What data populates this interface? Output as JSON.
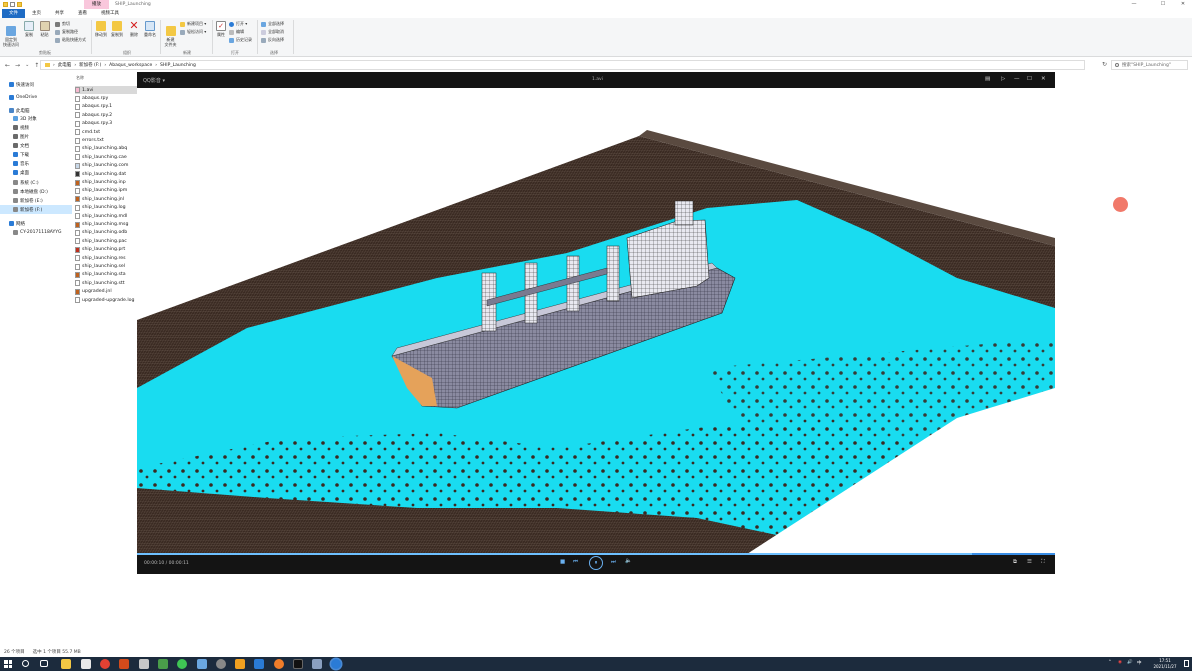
{
  "window": {
    "title": "SHIP_Launching",
    "context_tab": "播放",
    "controls": {
      "minimize": "—",
      "maximize": "☐",
      "close": "✕"
    }
  },
  "ribbon_tabs": [
    "文件",
    "主页",
    "共享",
    "查看",
    "视频工具"
  ],
  "ribbon": {
    "clipboard": {
      "pin_quick": "固定到\n快速访问",
      "copy": "复制",
      "paste": "粘贴",
      "cut": "剪切",
      "copy_path": "复制路径",
      "paste_shortcut": "粘贴快捷方式",
      "group": "剪贴板"
    },
    "organize": {
      "move_to": "移动到",
      "copy_to": "复制到",
      "delete": "删除",
      "rename": "重命名",
      "group": "组织"
    },
    "new": {
      "new_folder": "新建\n文件夹",
      "new_item": "新建项目 ▾",
      "easy_access": "轻松访问 ▾",
      "group": "新建"
    },
    "open": {
      "properties": "属性",
      "open": "打开 ▾",
      "edit": "编辑",
      "history": "历史记录",
      "group": "打开"
    },
    "select": {
      "select_all": "全部选择",
      "select_none": "全部取消",
      "invert": "反向选择",
      "group": "选择"
    }
  },
  "address": {
    "back": "←",
    "forward": "→",
    "recent": "⌄",
    "up": "↑",
    "crumbs": [
      "此电脑",
      "新加卷 (F:)",
      "Abaqus_workspace",
      "SHIP_Launching"
    ],
    "refresh": "↻",
    "search_placeholder": "搜索\"SHIP_Launching\""
  },
  "nav": [
    {
      "label": "快速访问",
      "indent": 0,
      "color": "#2a7bd6"
    },
    {
      "label": "OneDrive",
      "indent": 0,
      "color": "#2a7bd6"
    },
    {
      "label": "此电脑",
      "indent": 0,
      "color": "#4a86c8"
    },
    {
      "label": "3D 对象",
      "indent": 1,
      "color": "#5aa0e0"
    },
    {
      "label": "视频",
      "indent": 1,
      "color": "#6a6a6a"
    },
    {
      "label": "图片",
      "indent": 1,
      "color": "#6a6a6a"
    },
    {
      "label": "文档",
      "indent": 1,
      "color": "#6a6a6a"
    },
    {
      "label": "下载",
      "indent": 1,
      "color": "#2a7bd6"
    },
    {
      "label": "音乐",
      "indent": 1,
      "color": "#2a7bd6"
    },
    {
      "label": "桌面",
      "indent": 1,
      "color": "#2a7bd6"
    },
    {
      "label": "系统 (C:)",
      "indent": 1,
      "color": "#888"
    },
    {
      "label": "本地磁盘 (D:)",
      "indent": 1,
      "color": "#888"
    },
    {
      "label": "新加卷 (E:)",
      "indent": 1,
      "color": "#888"
    },
    {
      "label": "新加卷 (F:)",
      "indent": 1,
      "color": "#888",
      "selected": true
    },
    {
      "label": "网络",
      "indent": 0,
      "color": "#2a7bd6"
    },
    {
      "label": "CY-20171118AYYG",
      "indent": 1,
      "color": "#888"
    }
  ],
  "filelist": {
    "header": "名称",
    "files": [
      {
        "name": "1.avi",
        "icon": "video",
        "selected": true
      },
      {
        "name": "abaqus.rpy",
        "icon": "doc"
      },
      {
        "name": "abaqus.rpy.1",
        "icon": "doc"
      },
      {
        "name": "abaqus.rpy.2",
        "icon": "doc"
      },
      {
        "name": "abaqus.rpy.3",
        "icon": "doc"
      },
      {
        "name": "cmd.txt",
        "icon": "doc"
      },
      {
        "name": "errors.txt",
        "icon": "doc"
      },
      {
        "name": "ship_launching.abq",
        "icon": "doc"
      },
      {
        "name": "ship_launching.cae",
        "icon": "doc"
      },
      {
        "name": "ship_launching.com",
        "icon": "app"
      },
      {
        "name": "ship_launching.dat",
        "icon": "dark"
      },
      {
        "name": "ship_launching.inp",
        "icon": "abaqus"
      },
      {
        "name": "ship_launching.ipm",
        "icon": "doc"
      },
      {
        "name": "ship_launching.jnl",
        "icon": "abaqus"
      },
      {
        "name": "ship_launching.log",
        "icon": "doc"
      },
      {
        "name": "ship_launching.mdl",
        "icon": "doc"
      },
      {
        "name": "ship_launching.msg",
        "icon": "abaqus"
      },
      {
        "name": "ship_launching.odb",
        "icon": "doc"
      },
      {
        "name": "ship_launching.pac",
        "icon": "doc"
      },
      {
        "name": "ship_launching.prt",
        "icon": "red"
      },
      {
        "name": "ship_launching.res",
        "icon": "doc"
      },
      {
        "name": "ship_launching.sel",
        "icon": "doc"
      },
      {
        "name": "ship_launching.sta",
        "icon": "abaqus"
      },
      {
        "name": "ship_launching.stt",
        "icon": "doc"
      },
      {
        "name": "upgraded.jnl",
        "icon": "abaqus"
      },
      {
        "name": "upgraded-upgrade.log",
        "icon": "doc"
      }
    ]
  },
  "player": {
    "app_name": "QQ影音 ▾",
    "file_title": "1.avi",
    "top_controls": [
      "▤",
      "▷",
      "—",
      "☐",
      "✕"
    ],
    "time": "00:00:10 / 00:00:11",
    "progress": 0.91,
    "buttons": {
      "stop": "■",
      "prev": "⏮",
      "pause": "⏸",
      "next": "⏭",
      "volume": "🔈"
    },
    "right_buttons": [
      "⧉",
      "☰",
      "⛶"
    ]
  },
  "status": {
    "count": "26 个项目",
    "selected": "选中 1 个项目 55.7 MB"
  },
  "taskbar": {
    "clock_time": "17:51",
    "clock_date": "2021/11/27",
    "tray_icons": [
      "⌃",
      "◉",
      "🔊",
      "中"
    ]
  },
  "colors": {
    "accent": "#1e6bc4",
    "water": "#19dcf0",
    "mesh": "#3a2a22",
    "taskbar": "#1c2b3d"
  }
}
